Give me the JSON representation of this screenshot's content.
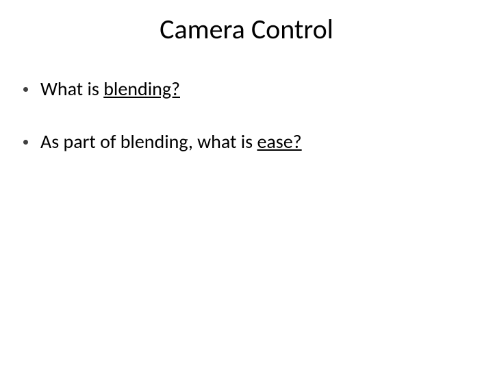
{
  "slide": {
    "title": "Camera Control",
    "bullets": [
      {
        "prefix": "What is ",
        "underlined": "blending?",
        "suffix": ""
      },
      {
        "prefix": "As part of blending, what is ",
        "underlined": "ease?",
        "suffix": ""
      }
    ]
  }
}
